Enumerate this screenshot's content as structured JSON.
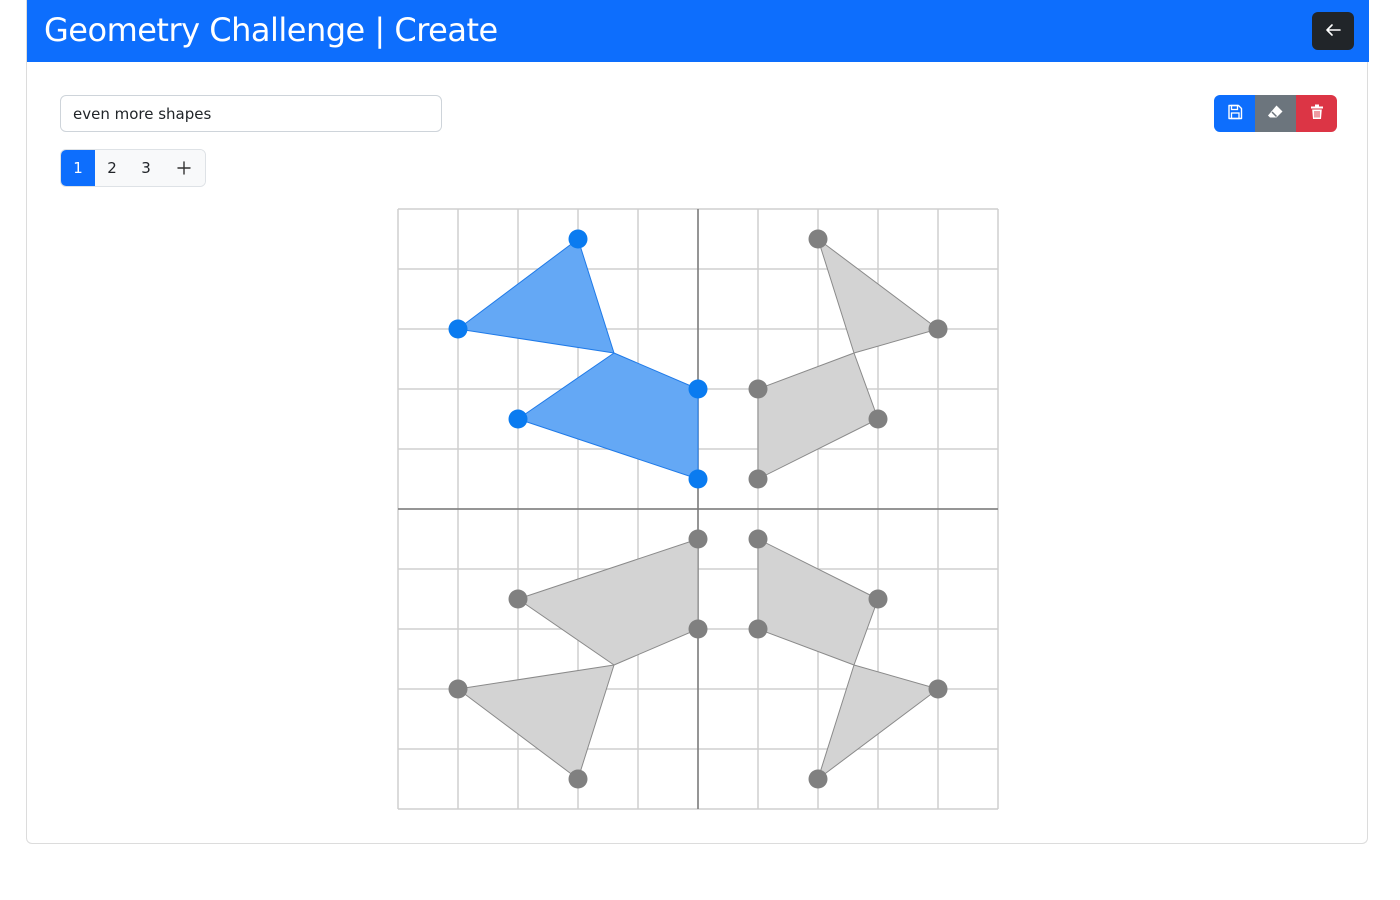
{
  "header": {
    "title": "Geometry Challenge | Create",
    "back_label": "←"
  },
  "challenge": {
    "name_value": "even more shapes"
  },
  "toolbar": {
    "save_icon": "floppy-disk-icon",
    "erase_icon": "eraser-icon",
    "delete_icon": "trash-icon"
  },
  "pages": {
    "items": [
      {
        "label": "1",
        "active": true
      },
      {
        "label": "2",
        "active": false
      },
      {
        "label": "3",
        "active": false
      }
    ],
    "add_label": "+"
  },
  "colors": {
    "primary": "#0d6efd",
    "dark": "#212529",
    "secondary": "#6c757d",
    "danger": "#dc3545",
    "active_shape_fill": "#64a8f5",
    "active_vertex": "#0a7bf0",
    "ghost_fill": "#d3d3d3",
    "ghost_vertex": "#808080"
  },
  "grid": {
    "cells": 10,
    "range": [
      -5,
      5
    ]
  },
  "shapes": {
    "active": [
      {
        "points": [
          [
            -4,
            3
          ],
          [
            -2,
            4.5
          ],
          [
            -1.4,
            2.6
          ]
        ]
      },
      {
        "points": [
          [
            -1.4,
            2.6
          ],
          [
            0,
            2
          ],
          [
            0,
            0.5
          ],
          [
            -3,
            1.5
          ]
        ]
      }
    ],
    "active_vertices": [
      [
        -2,
        4.5
      ],
      [
        -4,
        3
      ],
      [
        0,
        2
      ],
      [
        -3,
        1.5
      ],
      [
        0,
        0.5
      ]
    ],
    "ghost": [
      {
        "points": [
          [
            2,
            4.5
          ],
          [
            4,
            3
          ],
          [
            2.6,
            2.6
          ]
        ]
      },
      {
        "points": [
          [
            2.6,
            2.6
          ],
          [
            1,
            2
          ],
          [
            1,
            0.5
          ],
          [
            3,
            1.5
          ]
        ]
      },
      {
        "points": [
          [
            -1.4,
            -2.6
          ],
          [
            0,
            -2
          ],
          [
            0,
            -0.5
          ],
          [
            -3,
            -1.5
          ]
        ]
      },
      {
        "points": [
          [
            -4,
            -3
          ],
          [
            -2,
            -4.5
          ],
          [
            -1.4,
            -2.6
          ]
        ]
      },
      {
        "points": [
          [
            2.6,
            -2.6
          ],
          [
            1,
            -2
          ],
          [
            1,
            -0.5
          ],
          [
            3,
            -1.5
          ]
        ]
      },
      {
        "points": [
          [
            2,
            -4.5
          ],
          [
            4,
            -3
          ],
          [
            2.6,
            -2.6
          ]
        ]
      }
    ],
    "ghost_vertices": [
      [
        2,
        4.5
      ],
      [
        4,
        3
      ],
      [
        1,
        2
      ],
      [
        3,
        1.5
      ],
      [
        1,
        0.5
      ],
      [
        0,
        -0.5
      ],
      [
        -3,
        -1.5
      ],
      [
        0,
        -2
      ],
      [
        -4,
        -3
      ],
      [
        -2,
        -4.5
      ],
      [
        1,
        -0.5
      ],
      [
        3,
        -1.5
      ],
      [
        1,
        -2
      ],
      [
        4,
        -3
      ],
      [
        2,
        -4.5
      ]
    ]
  }
}
